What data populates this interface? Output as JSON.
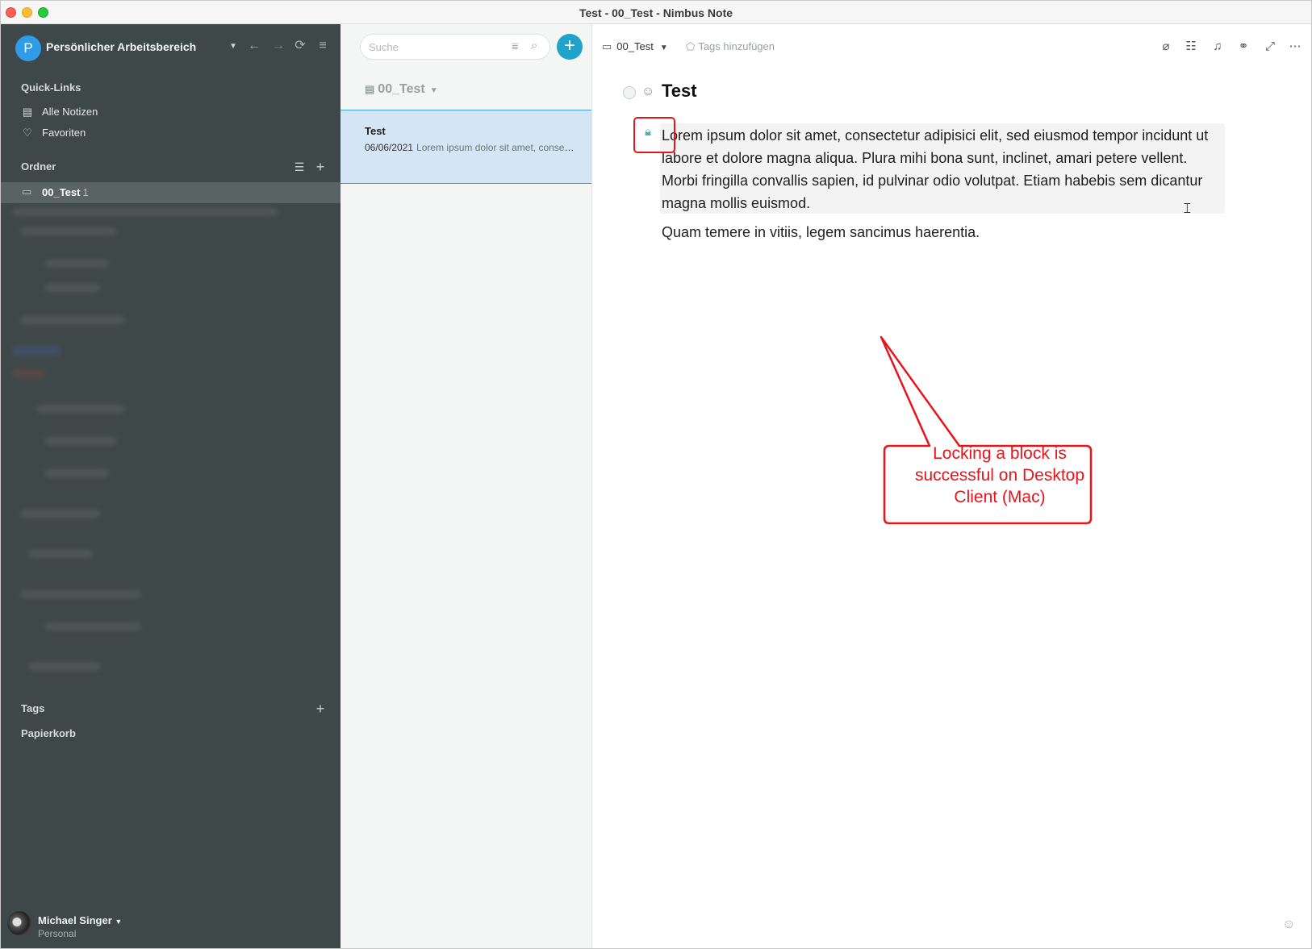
{
  "window": {
    "title": "Test - 00_Test - Nimbus Note"
  },
  "sidebar": {
    "workspace_initial": "P",
    "workspace_name": "Persönlicher Arbeitsbereich",
    "quicklinks_title": "Quick-Links",
    "quicklinks": [
      {
        "label": "Alle Notizen",
        "icon": "notes-icon"
      },
      {
        "label": "Favoriten",
        "icon": "heart-icon"
      }
    ],
    "folders_title": "Ordner",
    "active_folder": {
      "name": "00_Test",
      "count": "1"
    },
    "tags_title": "Tags",
    "trash_title": "Papierkorb",
    "user": {
      "name": "Michael Singer",
      "plan": "Personal"
    }
  },
  "notelist": {
    "search_placeholder": "Suche",
    "folder_label": "00_Test",
    "notes": [
      {
        "title": "Test",
        "date": "06/06/2021",
        "snippet": "Lorem ipsum dolor sit amet, consectetur adipisici elit"
      }
    ]
  },
  "editor": {
    "breadcrumb_folder": "00_Test",
    "tags_placeholder": "Tags hinzufügen",
    "note_title": "Test",
    "paragraphs": [
      "Lorem ipsum dolor sit amet, consectetur adipisici elit, sed eiusmod tempor incidunt ut labore et dolore magna aliqua. Plura mihi bona sunt, inclinet, amari petere vellent. Morbi fringilla convallis sapien, id pulvinar odio volutpat. Etiam habebis sem dicantur magna mollis euismod.",
      "Quam temere in vitiis, legem sancimus haerentia."
    ],
    "annotation": "Locking a block is successful on Desktop Client (Mac)"
  },
  "colors": {
    "accent": "#1fa3c8",
    "sidebar_bg": "#3f4849",
    "selected_note": "#d4e6f6",
    "annotation": "#e8141b"
  }
}
